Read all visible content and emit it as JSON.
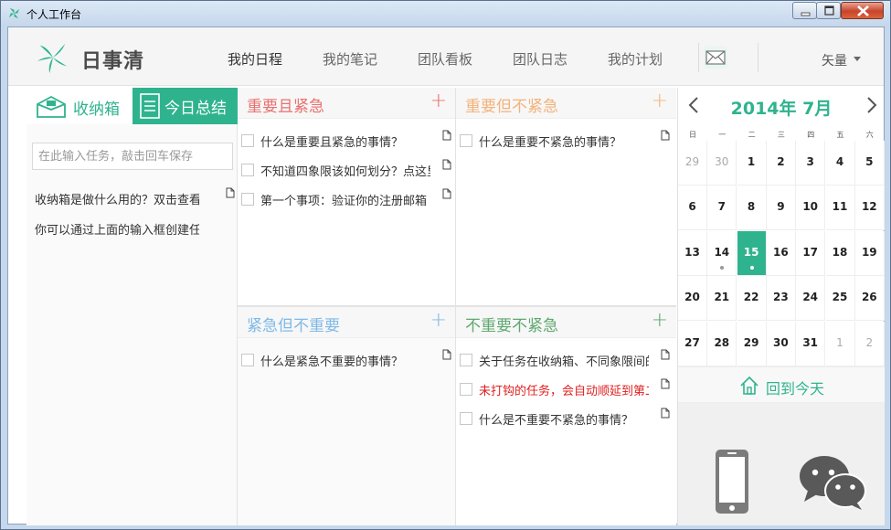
{
  "window": {
    "title": "个人工作台"
  },
  "app": {
    "logo_text": "日事清"
  },
  "nav": {
    "tabs": [
      {
        "label": "我的日程",
        "active": true
      },
      {
        "label": "我的笔记"
      },
      {
        "label": "团队看板"
      },
      {
        "label": "团队日志"
      },
      {
        "label": "我的计划"
      }
    ],
    "mail_icon": "mail-icon",
    "user_name": "矢量"
  },
  "left_panel": {
    "inbox_tab": "收纳箱",
    "summary_tab": "今日总结",
    "input_placeholder": "在此输入任务，敲击回车保存",
    "items": [
      "收纳箱是做什么用的？双击查看详情",
      "你可以通过上面的输入框创建任务"
    ]
  },
  "quadrants": [
    {
      "title": "重要且紧急",
      "color": "#e9706e",
      "add": "+",
      "tasks": [
        {
          "text": "什么是重要且紧急的事情？"
        },
        {
          "text": "不知道四象限该如何划分？点这里"
        },
        {
          "text": "第一个事项：验证你的注册邮箱"
        }
      ]
    },
    {
      "title": "重要但不紧急",
      "color": "#f3b27a",
      "add": "+",
      "tasks": [
        {
          "text": "什么是重要不紧急的事情？"
        }
      ]
    },
    {
      "title": "紧急但不重要",
      "color": "#7eb9e6",
      "add": "+",
      "tasks": [
        {
          "text": "什么是紧急不重要的事情？"
        }
      ]
    },
    {
      "title": "不重要不紧急",
      "color": "#5fa86f",
      "add": "+",
      "tasks": [
        {
          "text": "关于任务在收纳箱、不同象限间的拖动"
        },
        {
          "text": "未打钩的任务，会自动顺延到第二天",
          "red": true
        },
        {
          "text": "什么是不重要不紧急的事情？"
        }
      ]
    }
  ],
  "calendar": {
    "title": "2014年 7月",
    "weekdays": [
      "日",
      "一",
      "二",
      "三",
      "四",
      "五",
      "六"
    ],
    "weeks": [
      [
        {
          "d": "29",
          "o": true
        },
        {
          "d": "30",
          "o": true
        },
        {
          "d": "1"
        },
        {
          "d": "2"
        },
        {
          "d": "3"
        },
        {
          "d": "4"
        },
        {
          "d": "5"
        }
      ],
      [
        {
          "d": "6"
        },
        {
          "d": "7"
        },
        {
          "d": "8"
        },
        {
          "d": "9"
        },
        {
          "d": "10"
        },
        {
          "d": "11"
        },
        {
          "d": "12"
        }
      ],
      [
        {
          "d": "13"
        },
        {
          "d": "14",
          "dot": true
        },
        {
          "d": "15",
          "today": true,
          "dot": true
        },
        {
          "d": "16"
        },
        {
          "d": "17"
        },
        {
          "d": "18"
        },
        {
          "d": "19"
        }
      ],
      [
        {
          "d": "20"
        },
        {
          "d": "21"
        },
        {
          "d": "22"
        },
        {
          "d": "23"
        },
        {
          "d": "24"
        },
        {
          "d": "25"
        },
        {
          "d": "26"
        }
      ],
      [
        {
          "d": "27"
        },
        {
          "d": "28"
        },
        {
          "d": "29"
        },
        {
          "d": "30"
        },
        {
          "d": "31"
        },
        {
          "d": "1",
          "o": true
        },
        {
          "d": "2",
          "o": true
        }
      ]
    ],
    "back_today": "回到今天",
    "accent": "#2fb38e"
  }
}
